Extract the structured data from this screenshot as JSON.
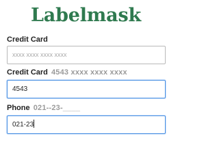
{
  "app": {
    "title": "Labelmask",
    "accent_color": "#2f7a4f"
  },
  "fields": [
    {
      "label": "Credit Card",
      "mask_hint": "",
      "value": "",
      "placeholder": "xxxx xxxx xxxx xxxx"
    },
    {
      "label": "Credit Card",
      "mask_hint": "4543 xxxx xxxx xxxx",
      "value": "4543",
      "placeholder": ""
    },
    {
      "label": "Phone",
      "mask_hint": "021--23-____",
      "value": "021-23",
      "placeholder": ""
    }
  ]
}
